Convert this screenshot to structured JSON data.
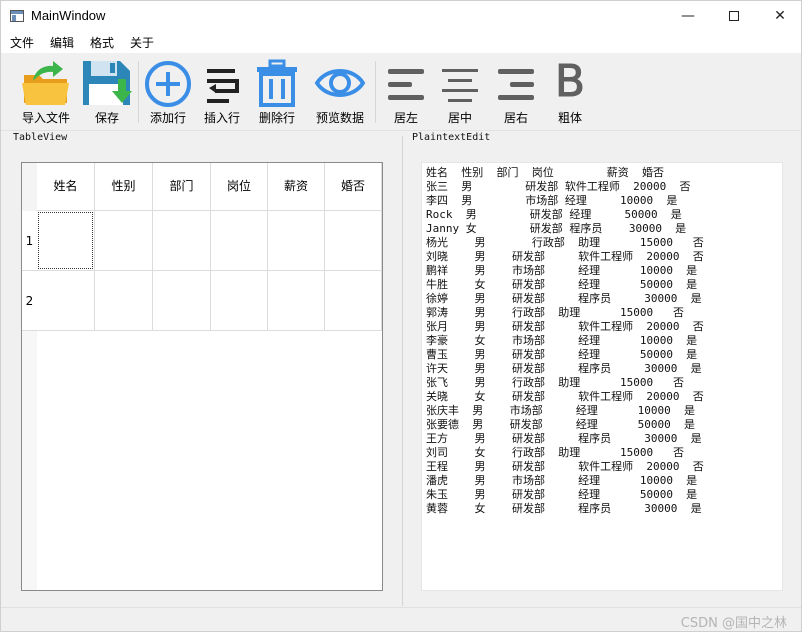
{
  "window": {
    "title": "MainWindow",
    "minimize_glyph": "—",
    "close_glyph": "✕"
  },
  "menu": [
    "文件",
    "编辑",
    "格式",
    "关于"
  ],
  "toolbar": {
    "import_label": "导入文件",
    "save_label": "保存",
    "add_row_label": "添加行",
    "insert_row_label": "插入行",
    "delete_row_label": "删除行",
    "preview_label": "预览数据",
    "align_left_label": "居左",
    "align_center_label": "居中",
    "align_right_label": "居右",
    "bold_label": "粗体",
    "bold_glyph": "B"
  },
  "table_view": {
    "title": "TableView",
    "columns": [
      "姓名",
      "性别",
      "部门",
      "岗位",
      "薪资",
      "婚否"
    ],
    "rows": [
      "1",
      "2"
    ]
  },
  "plaintext_edit": {
    "title": "PlaintextEdit",
    "lines": [
      "姓名  性别  部门  岗位        薪资  婚否",
      "张三  男        研发部 软件工程师  20000  否",
      "李四  男        市场部 经理     10000  是",
      "Rock  男        研发部 经理     50000  是",
      "Janny 女        研发部 程序员    30000  是",
      "杨光    男       行政部  助理      15000   否",
      "刘晓    男    研发部     软件工程师  20000  否",
      "鹏祥    男    市场部     经理      10000  是",
      "牛胜    女    研发部     经理      50000  是",
      "徐婷    男    研发部     程序员     30000  是",
      "郭涛    男    行政部  助理      15000   否",
      "张月    男    研发部     软件工程师  20000  否",
      "李豪    女    市场部     经理      10000  是",
      "曹玉    男    研发部     经理      50000  是",
      "许天    男    研发部     程序员     30000  是",
      "张飞    男    行政部  助理      15000   否",
      "关晓    女    研发部     软件工程师  20000  否",
      "张庆丰  男    市场部     经理      10000  是",
      "张要德  男    研发部     经理      50000  是",
      "王方    男    研发部     程序员     30000  是",
      "刘司    女    行政部  助理      15000   否",
      "王程    男    研发部     软件工程师  20000  否",
      "潘虎    男    市场部     经理      10000  是",
      "朱玉    男    研发部     经理      50000  是",
      "黄蓉    女    研发部     程序员     30000  是"
    ]
  },
  "watermark": "CSDN @国中之林",
  "colors": {
    "accent_blue": "#3a8ee6",
    "folder_yellow": "#f5b731",
    "arrow_green": "#3cb54a",
    "gray_icon": "#606060"
  }
}
